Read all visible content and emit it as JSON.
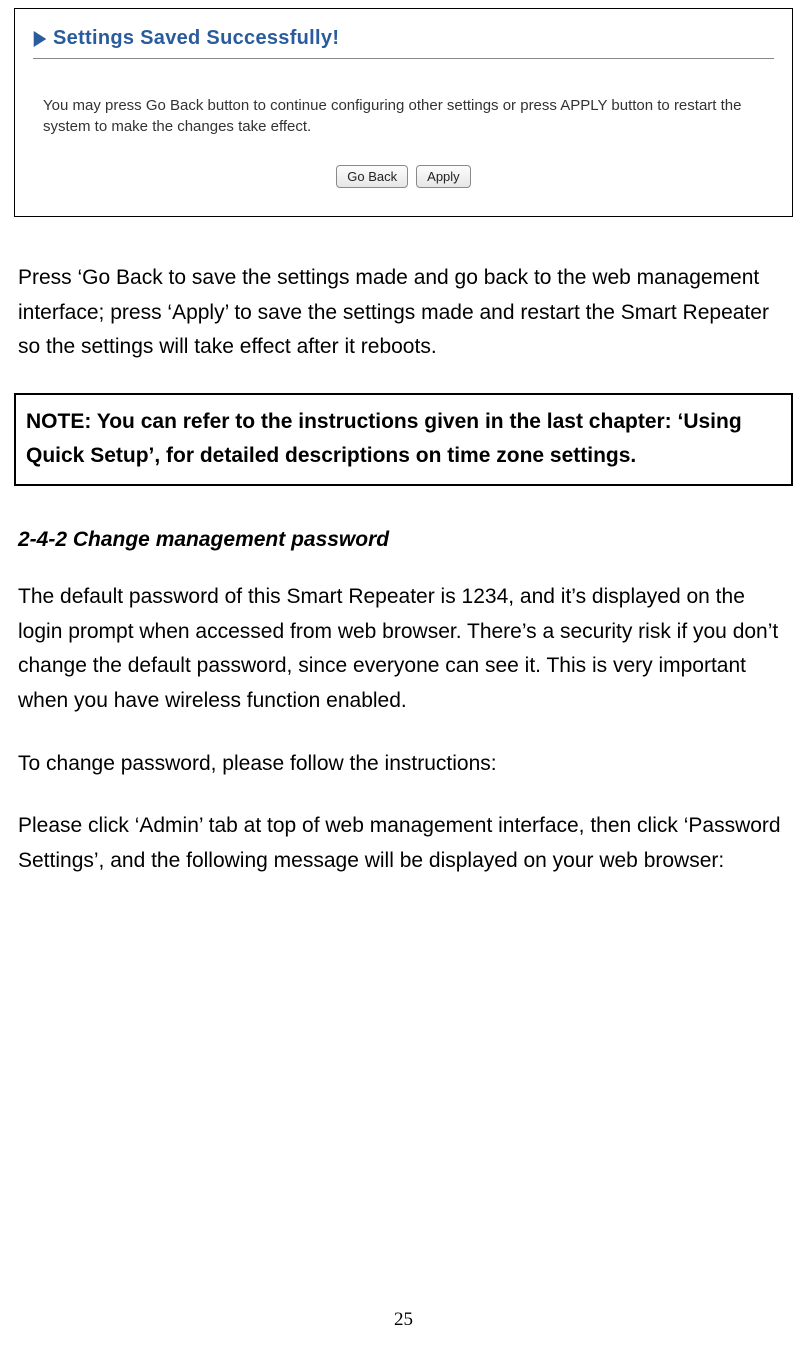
{
  "screenshot": {
    "title": "Settings Saved Successfully!",
    "description": "You may press Go Back button to continue configuring other settings or press APPLY button to restart the system to make the changes take effect.",
    "buttons": {
      "go_back": "Go Back",
      "apply": "Apply"
    }
  },
  "paragraph1": "Press ‘Go Back to save the settings made and go back to the web management interface; press ‘Apply’ to save the settings made and restart the Smart Repeater so the settings will take effect after it reboots.",
  "note_box": "NOTE: You can refer to the instructions given in the last chapter: ‘Using Quick Setup’, for detailed descriptions on time zone settings.",
  "section_heading": "2-4-2 Change management password",
  "paragraph2": "The default password of this Smart Repeater is 1234, and it’s displayed on the login prompt when accessed from web browser. There’s a security risk if you don’t change the default password, since everyone can see it. This is very important when you have wireless function enabled.",
  "paragraph3": "To change password, please follow the instructions:",
  "paragraph4": "Please click ‘Admin’ tab at top of web management interface, then click ‘Password Settings’, and the following message will be displayed on your web browser:",
  "page_number": "25"
}
